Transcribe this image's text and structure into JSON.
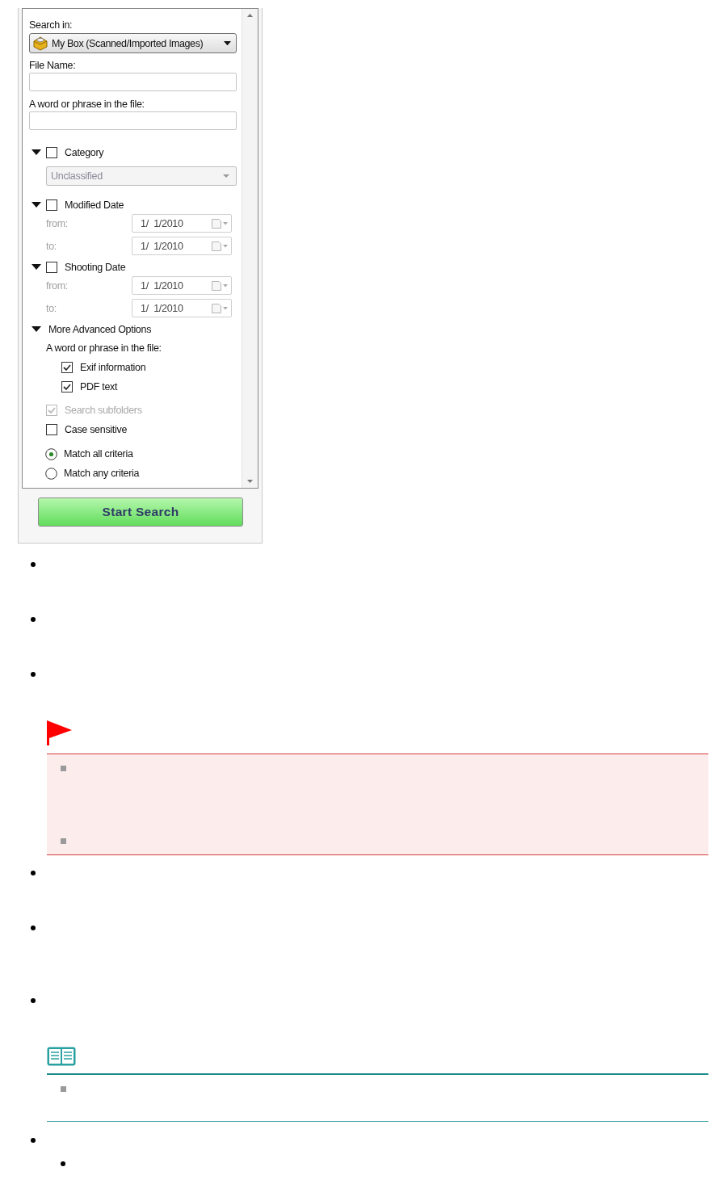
{
  "search_panel": {
    "search_in": {
      "label": "Search in:",
      "value": "My Box (Scanned/Imported Images)"
    },
    "file_name": {
      "label": "File Name:"
    },
    "phrase": {
      "label": "A word or phrase in the file:"
    },
    "sections": [
      {
        "kind": "dropdown",
        "label": "Category",
        "expanded": true,
        "checked": false,
        "dropdown": {
          "value": "Unclassified",
          "disabled": true
        }
      },
      {
        "kind": "date_range",
        "label": "Modified Date",
        "expanded": true,
        "checked": false,
        "rows": [
          {
            "label": "from:",
            "value": "1/  1/2010"
          },
          {
            "label": "to:",
            "value": "1/  1/2010"
          }
        ]
      },
      {
        "kind": "date_range",
        "label": "Shooting Date",
        "expanded": true,
        "checked": false,
        "rows": [
          {
            "label": "from:",
            "value": "1/  1/2010"
          },
          {
            "label": "to:",
            "value": "1/  1/2010"
          }
        ]
      }
    ],
    "advanced": {
      "label": "More Advanced Options",
      "expanded": true,
      "sub_label": "A word or phrase in the file:",
      "targets": [
        {
          "label": "Exif information",
          "checked": true
        },
        {
          "label": "PDF text",
          "checked": true
        }
      ]
    },
    "options": [
      {
        "label": "Search subfolders",
        "checked": true,
        "disabled": true
      },
      {
        "label": "Case sensitive",
        "checked": false,
        "disabled": false
      }
    ],
    "match": [
      {
        "label": "Match all criteria",
        "selected": true
      },
      {
        "label": "Match any criteria",
        "selected": false
      }
    ],
    "start_button": "Start Search"
  },
  "doc": [
    {
      "kind": "bullet"
    },
    {
      "kind": "bullet"
    },
    {
      "kind": "bullet"
    },
    {
      "kind": "caution",
      "items": [
        {
          "kind": "square"
        },
        {
          "kind": "square"
        }
      ]
    },
    {
      "kind": "bullet"
    },
    {
      "kind": "bullet"
    },
    {
      "kind": "bullet"
    },
    {
      "kind": "note",
      "items": [
        {
          "kind": "square"
        }
      ]
    },
    {
      "kind": "bullet",
      "children": [
        {
          "kind": "bullet"
        }
      ]
    }
  ]
}
